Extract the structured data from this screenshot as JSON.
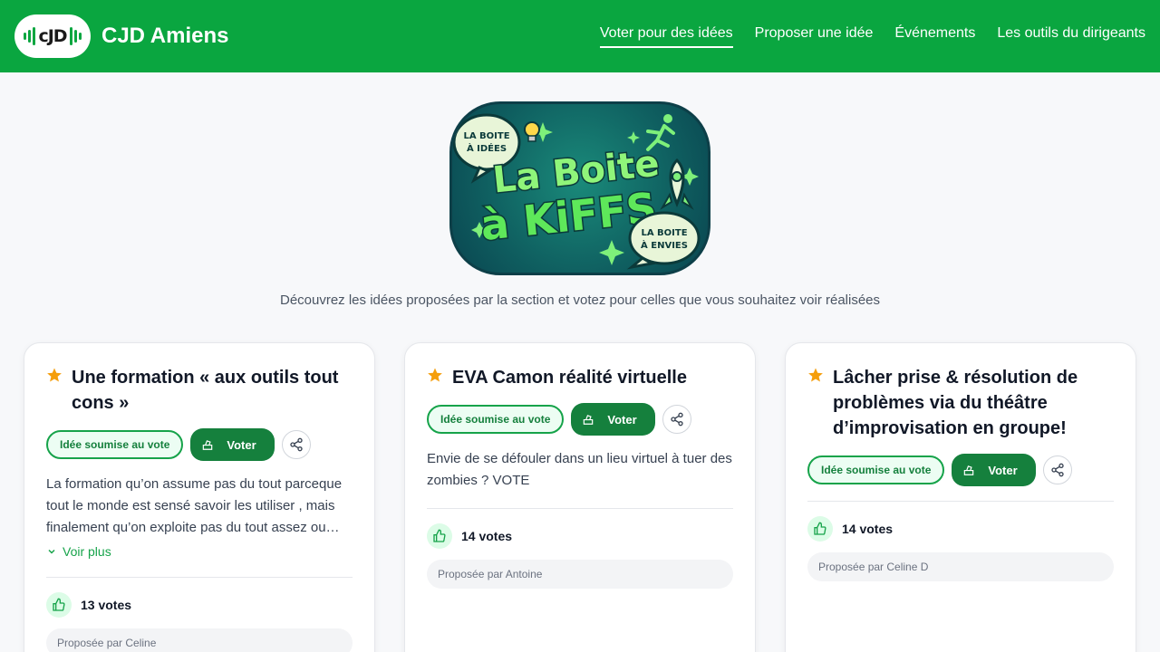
{
  "header": {
    "logo_text": "cJD",
    "brand": "CJD Amiens",
    "nav": [
      {
        "label": "Voter pour des idées",
        "active": true
      },
      {
        "label": "Proposer une idée",
        "active": false
      },
      {
        "label": "Événements",
        "active": false
      },
      {
        "label": "Les outils du dirigeants",
        "active": false
      }
    ]
  },
  "hero": {
    "title_line1": "La Boite",
    "title_line2": "à KiFFS",
    "bubble_left": "LA BOITE À IDÉES",
    "bubble_right": "LA BOITE À ENVIES"
  },
  "subtitle": "Découvrez les idées proposées par la section et votez pour celles que vous souhaitez voir réalisées",
  "colors": {
    "brand_green": "#0aa640",
    "vote_green": "#15803d",
    "star": "#f59e0b"
  },
  "cards": [
    {
      "title": "Une formation « aux outils tout cons »",
      "badge": "Idée soumise au vote",
      "vote_label": "Voter",
      "description": "La formation qu’on assume pas du tout parceque tout le monde est sensé savoir les utiliser , mais finalement qu’on exploite pas du tout assez ou…",
      "more_label": "Voir plus",
      "votes": "13 votes",
      "author": "Proposée par Celine"
    },
    {
      "title": "EVA Camon réalité virtuelle",
      "badge": "Idée soumise au vote",
      "vote_label": "Voter",
      "description": "Envie de se défouler dans un lieu virtuel à tuer des zombies ? VOTE",
      "votes": "14 votes",
      "author": "Proposée par Antoine"
    },
    {
      "title": "Lâcher prise & résolution de problèmes via du théâtre d’improvisation en groupe!",
      "badge": "Idée soumise au vote",
      "vote_label": "Voter",
      "votes": "14 votes",
      "author": "Proposée par Celine D"
    }
  ]
}
